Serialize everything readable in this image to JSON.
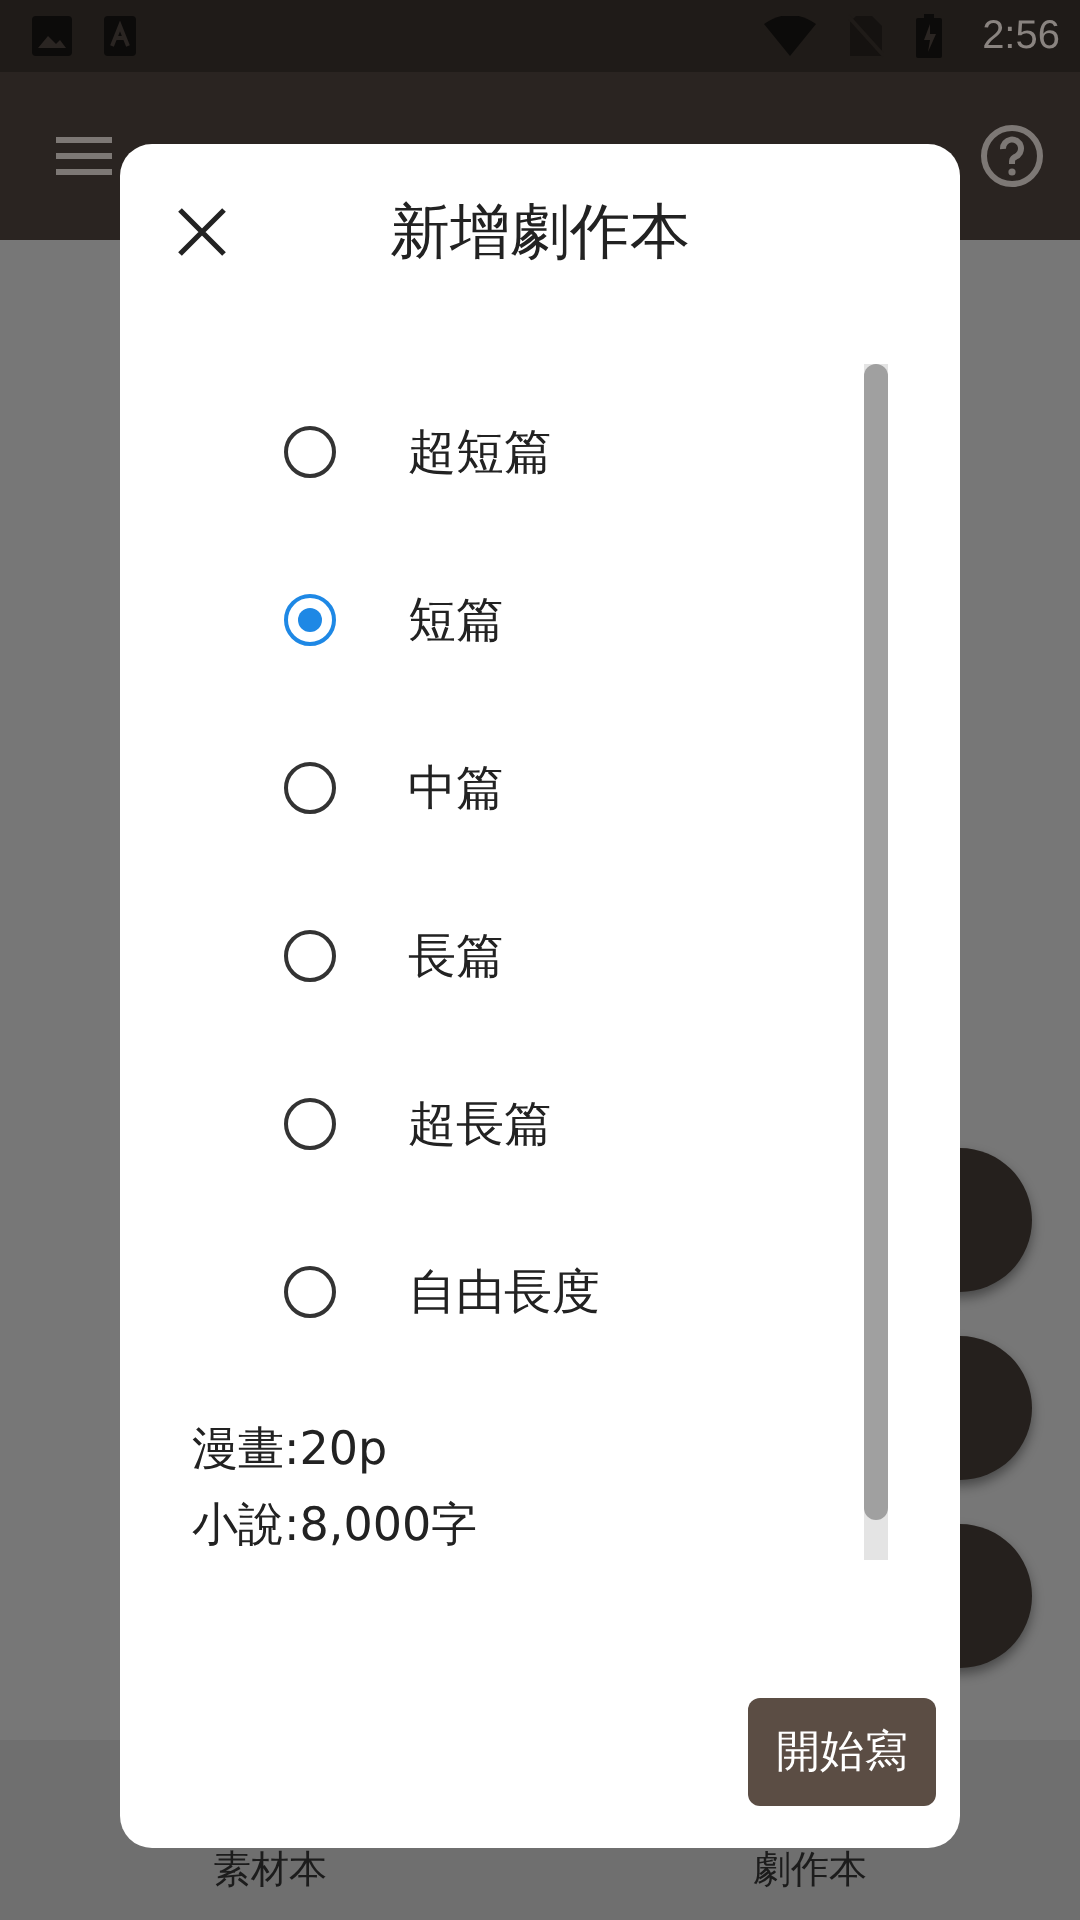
{
  "status_bar": {
    "time": "2:56"
  },
  "dialog": {
    "title": "新增劇作本",
    "options": [
      {
        "label": "超短篇",
        "selected": false
      },
      {
        "label": "短篇",
        "selected": true
      },
      {
        "label": "中篇",
        "selected": false
      },
      {
        "label": "長篇",
        "selected": false
      },
      {
        "label": "超長篇",
        "selected": false
      },
      {
        "label": "自由長度",
        "selected": false
      }
    ],
    "details": [
      "漫畫:20p",
      "小說:8,000字"
    ],
    "button": "開始寫"
  },
  "bottom_nav": [
    {
      "label": "素材本"
    },
    {
      "label": "劇作本"
    }
  ]
}
